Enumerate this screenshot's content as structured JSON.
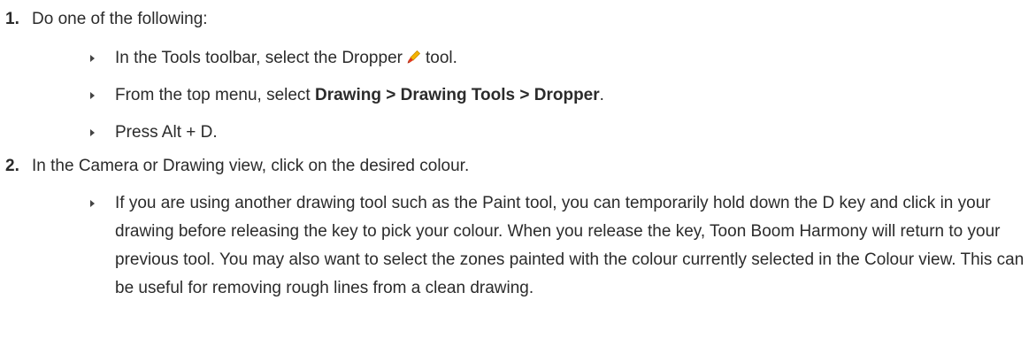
{
  "steps": [
    {
      "number": "1.",
      "text": "Do one of the following:",
      "subitems": [
        {
          "before": "In the Tools toolbar, select the Dropper",
          "icon": "dropper-icon",
          "after": "tool."
        },
        {
          "before": "From the top menu, select ",
          "bold": "Drawing > Drawing Tools > Dropper",
          "after": "."
        },
        {
          "text": "Press Alt + D."
        }
      ]
    },
    {
      "number": "2.",
      "text": "In the Camera or Drawing view, click on the desired colour.",
      "subitems": [
        {
          "text": "If you are using another drawing tool such as the Paint tool, you can temporarily hold down the D key and click in your drawing before releasing the key to pick your colour. When you release the key, Toon Boom Harmony will return to your previous tool. You may also want to select the zones painted with the colour currently selected in the Colour view. This can be useful for removing rough lines from a clean drawing."
        }
      ]
    }
  ],
  "colors": {
    "text": "#2b2b2b",
    "bullet": "#444444",
    "dropper_body": "#f5b400",
    "dropper_tip": "#e03a1e"
  }
}
